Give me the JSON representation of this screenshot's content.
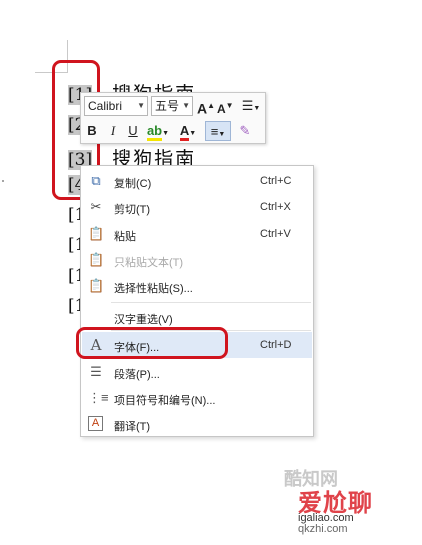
{
  "document": {
    "lines": [
      {
        "num": "[1]",
        "text": "搜狗指南"
      },
      {
        "num": "[2",
        "text": ""
      },
      {
        "num": "[3]",
        "text": "搜狗指南"
      },
      {
        "num": "[4",
        "text": ""
      },
      {
        "num": "[1",
        "text": ""
      },
      {
        "num": "[1",
        "text": ""
      },
      {
        "num": "[1",
        "text": ""
      },
      {
        "num": "[1",
        "text": ""
      }
    ]
  },
  "mini_toolbar": {
    "font_name": "Calibri",
    "font_size": "五号",
    "grow_font": "A",
    "shrink_font": "A",
    "bold": "B",
    "italic": "I",
    "underline": "U",
    "font_color": "A"
  },
  "context_menu": {
    "items": [
      {
        "label": "复制(C)",
        "shortcut": "Ctrl+C",
        "icon": "copy-icon"
      },
      {
        "label": "剪切(T)",
        "shortcut": "Ctrl+X",
        "icon": "scissors-icon"
      },
      {
        "label": "粘贴",
        "shortcut": "Ctrl+V",
        "icon": "paste-icon"
      },
      {
        "label": "只粘贴文本(T)",
        "shortcut": "",
        "icon": "paste-text-icon"
      },
      {
        "label": "选择性粘贴(S)...",
        "shortcut": "",
        "icon": "paste-special-icon"
      },
      {
        "label": "汉字重选(V)",
        "shortcut": "",
        "icon": ""
      },
      {
        "label": "字体(F)...",
        "shortcut": "Ctrl+D",
        "icon": "font-icon"
      },
      {
        "label": "段落(P)...",
        "shortcut": "",
        "icon": "paragraph-icon"
      },
      {
        "label": "项目符号和编号(N)...",
        "shortcut": "",
        "icon": "bullet-list-icon"
      },
      {
        "label": "翻译(T)",
        "shortcut": "",
        "icon": "translate-icon"
      }
    ]
  },
  "watermark": {
    "top_text": "酷知网",
    "main_text": "爱尬聊",
    "url1": "igaliao.com",
    "url2": "qkzhi.com"
  },
  "colors": {
    "annotation_red": "#d0141e",
    "highlight_blue": "#dfe9f7",
    "selection_gray": "#c6c6c6"
  }
}
